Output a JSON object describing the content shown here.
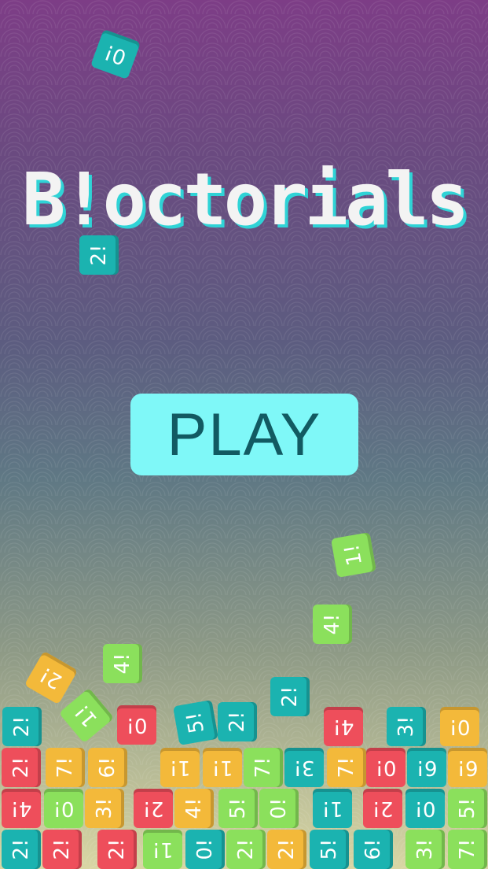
{
  "title": "B!octorials",
  "play_label": "PLAY",
  "colors": {
    "teal": "#1bb3b0",
    "red": "#ee4e5b",
    "green": "#8be05c",
    "yellow": "#f3b93a"
  },
  "tiles": [
    {
      "label": "0!",
      "color": "teal"
    },
    {
      "label": "2!",
      "color": "teal"
    },
    {
      "label": "1!",
      "color": "green"
    },
    {
      "label": "4!",
      "color": "green"
    },
    {
      "label": "4!",
      "color": "green"
    },
    {
      "label": "2!",
      "color": "yellow"
    },
    {
      "label": "1!",
      "color": "green"
    },
    {
      "label": "2!",
      "color": "teal"
    },
    {
      "label": "2!",
      "color": "teal"
    },
    {
      "label": "0!",
      "color": "red"
    },
    {
      "label": "5!",
      "color": "teal"
    },
    {
      "label": "2!",
      "color": "teal"
    },
    {
      "label": "4!",
      "color": "red"
    },
    {
      "label": "3!",
      "color": "teal"
    },
    {
      "label": "0!",
      "color": "yellow"
    },
    {
      "label": "2!",
      "color": "red"
    },
    {
      "label": "7!",
      "color": "yellow"
    },
    {
      "label": "6!",
      "color": "yellow"
    },
    {
      "label": "1!",
      "color": "yellow"
    },
    {
      "label": "1!",
      "color": "yellow"
    },
    {
      "label": "7!",
      "color": "green"
    },
    {
      "label": "3!",
      "color": "teal"
    },
    {
      "label": "7!",
      "color": "yellow"
    },
    {
      "label": "0!",
      "color": "red"
    },
    {
      "label": "6!",
      "color": "teal"
    },
    {
      "label": "6!",
      "color": "yellow"
    },
    {
      "label": "4!",
      "color": "red"
    },
    {
      "label": "0!",
      "color": "green"
    },
    {
      "label": "3!",
      "color": "yellow"
    },
    {
      "label": "2!",
      "color": "red"
    },
    {
      "label": "4!",
      "color": "yellow"
    },
    {
      "label": "5!",
      "color": "green"
    },
    {
      "label": "0!",
      "color": "green"
    },
    {
      "label": "1!",
      "color": "teal"
    },
    {
      "label": "2!",
      "color": "red"
    },
    {
      "label": "0!",
      "color": "teal"
    },
    {
      "label": "5!",
      "color": "green"
    },
    {
      "label": "2!",
      "color": "teal"
    },
    {
      "label": "2!",
      "color": "red"
    },
    {
      "label": "2!",
      "color": "red"
    },
    {
      "label": "1!",
      "color": "green"
    },
    {
      "label": "0!",
      "color": "teal"
    },
    {
      "label": "2!",
      "color": "green"
    },
    {
      "label": "2!",
      "color": "yellow"
    },
    {
      "label": "5!",
      "color": "teal"
    },
    {
      "label": "6!",
      "color": "teal"
    },
    {
      "label": "3!",
      "color": "green"
    },
    {
      "label": "7!",
      "color": "green"
    }
  ]
}
